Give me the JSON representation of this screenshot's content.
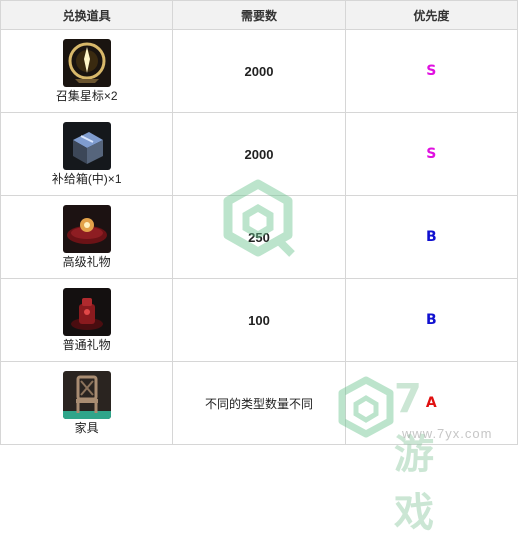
{
  "header": {
    "col_item": "兑换道具",
    "col_qty": "需要数",
    "col_priority": "优先度"
  },
  "rows": [
    {
      "name": "召集星标×2",
      "qty": "2000",
      "priority": "S",
      "priority_color": "#e010e0",
      "icon": "summon-star-icon"
    },
    {
      "name": "补给箱(中)×1",
      "qty": "2000",
      "priority": "S",
      "priority_color": "#e010e0",
      "icon": "supply-box-icon"
    },
    {
      "name": "高级礼物",
      "qty": "250",
      "priority": "B",
      "priority_color": "#1010d0",
      "icon": "premium-gift-icon"
    },
    {
      "name": "普通礼物",
      "qty": "100",
      "priority": "B",
      "priority_color": "#1010d0",
      "icon": "common-gift-icon"
    },
    {
      "name": "家具",
      "qty": "不同的类型数量不同",
      "priority": "A",
      "priority_color": "#e01010",
      "icon": "furniture-chair-icon"
    }
  ],
  "watermark": {
    "brand": "7游戏",
    "url": "www.7yx.com"
  }
}
